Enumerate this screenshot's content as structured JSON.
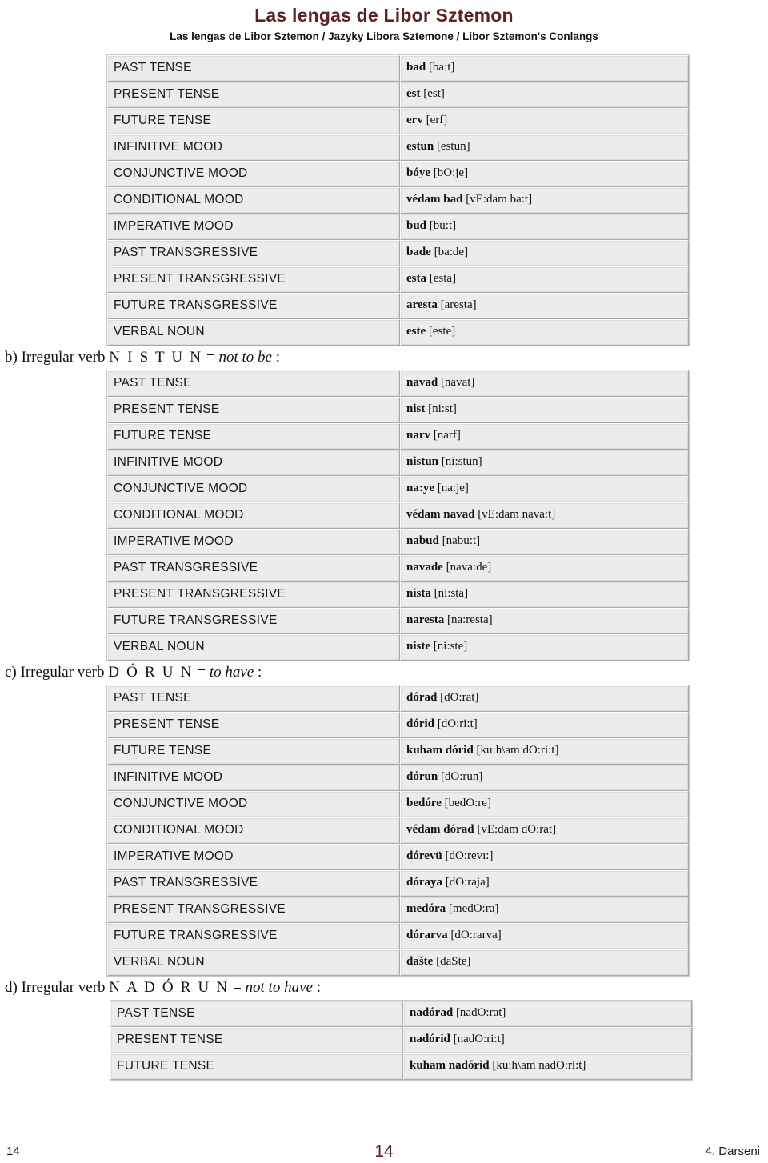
{
  "header": {
    "title": "Las lengas de Libor Sztemon",
    "subtitle": "Las lengas de Libor Sztemon / Jazyky Libora Sztemone / Libor Sztemon's Conlangs"
  },
  "sections": [
    {
      "id": "verb-a",
      "heading_prefix": "",
      "verb_name": "",
      "gloss": "",
      "rows": [
        {
          "label": "PAST TENSE",
          "form": "bad",
          "ipa": "[ba:t]"
        },
        {
          "label": "PRESENT TENSE",
          "form": "est",
          "ipa": "[est]"
        },
        {
          "label": "FUTURE TENSE",
          "form": "erv",
          "ipa": "[erf]"
        },
        {
          "label": "INFINITIVE MOOD",
          "form": "estun",
          "ipa": "[estun]"
        },
        {
          "label": "CONJUNCTIVE MOOD",
          "form": "bóye",
          "ipa": "[bO:je]"
        },
        {
          "label": "CONDITIONAL MOOD",
          "form": "védam bad",
          "ipa": "[vE:dam ba:t]"
        },
        {
          "label": "IMPERATIVE MOOD",
          "form": "bud",
          "ipa": "[bu:t]"
        },
        {
          "label": "PAST TRANSGRESSIVE",
          "form": "bade",
          "ipa": "[ba:de]"
        },
        {
          "label": "PRESENT TRANSGRESSIVE",
          "form": "esta",
          "ipa": "[esta]"
        },
        {
          "label": "FUTURE TRANSGRESSIVE",
          "form": "aresta",
          "ipa": "[aresta]"
        },
        {
          "label": "VERBAL NOUN",
          "form": "este",
          "ipa": "[este]"
        }
      ]
    },
    {
      "id": "verb-b",
      "heading_prefix": "b) Irregular verb ",
      "verb_name": "N I S T U N",
      "heading_equals": " = ",
      "gloss": "not to be",
      "heading_suffix": " :",
      "rows": [
        {
          "label": "PAST TENSE",
          "form": "navad",
          "ipa": "[navat]"
        },
        {
          "label": "PRESENT TENSE",
          "form": "nist",
          "ipa": "[ni:st]"
        },
        {
          "label": "FUTURE TENSE",
          "form": "narv",
          "ipa": "[narf]"
        },
        {
          "label": "INFINITIVE MOOD",
          "form": "nistun",
          "ipa": "[ni:stun]"
        },
        {
          "label": "CONJUNCTIVE MOOD",
          "form": "na:ye",
          "ipa": "[na:je]"
        },
        {
          "label": "CONDITIONAL MOOD",
          "form": "védam navad",
          "ipa": "[vE:dam nava:t]"
        },
        {
          "label": "IMPERATIVE MOOD",
          "form": "nabud",
          "ipa": "[nabu:t]"
        },
        {
          "label": "PAST TRANSGRESSIVE",
          "form": "navade",
          "ipa": "[nava:de]"
        },
        {
          "label": "PRESENT TRANSGRESSIVE",
          "form": "nista",
          "ipa": "[ni:sta]"
        },
        {
          "label": "FUTURE TRANSGRESSIVE",
          "form": "naresta",
          "ipa": "[na:resta]"
        },
        {
          "label": "VERBAL NOUN",
          "form": "niste",
          "ipa": "[ni:ste]"
        }
      ]
    },
    {
      "id": "verb-c",
      "heading_prefix": "c) Irregular verb ",
      "verb_name": "D Ó R U N",
      "heading_equals": " = ",
      "gloss": "to have",
      "heading_suffix": " :",
      "rows": [
        {
          "label": "PAST TENSE",
          "form": "dórad",
          "ipa": "[dO:rat]"
        },
        {
          "label": "PRESENT TENSE",
          "form": "dórid",
          "ipa": "[dO:ri:t]"
        },
        {
          "label": "FUTURE TENSE",
          "form": "kuham dórid",
          "ipa": "[ku:h\\am dO:ri:t]"
        },
        {
          "label": "INFINITIVE MOOD",
          "form": "dórun",
          "ipa": "[dO:run]"
        },
        {
          "label": "CONJUNCTIVE MOOD",
          "form": "bedóre",
          "ipa": "[bedO:re]"
        },
        {
          "label": "CONDITIONAL MOOD",
          "form": "védam dórad",
          "ipa": "[vE:dam dO:rat]"
        },
        {
          "label": "IMPERATIVE MOOD",
          "form": "dórevü",
          "ipa": "[dO:revı:]"
        },
        {
          "label": "PAST TRANSGRESSIVE",
          "form": "dóraya",
          "ipa": "[dO:raja]"
        },
        {
          "label": "PRESENT TRANSGRESSIVE",
          "form": "medóra",
          "ipa": "[medO:ra]"
        },
        {
          "label": "FUTURE TRANSGRESSIVE",
          "form": "dórarva",
          "ipa": "[dO:rarva]"
        },
        {
          "label": "VERBAL NOUN",
          "form": "dašte",
          "ipa": "[daSte]"
        }
      ]
    },
    {
      "id": "verb-d",
      "heading_prefix": "d) Irregular verb ",
      "verb_name": "N A D Ó R U N",
      "heading_equals": " = ",
      "gloss": "not to have",
      "heading_suffix": " :",
      "rows": [
        {
          "label": "PAST TENSE",
          "form": "nadórad",
          "ipa": "[nadO:rat]"
        },
        {
          "label": "PRESENT TENSE",
          "form": "nadórid",
          "ipa": "[nadO:ri:t]"
        },
        {
          "label": "FUTURE TENSE",
          "form": "kuham nadórid",
          "ipa": "[ku:h\\am nadO:ri:t]"
        }
      ]
    }
  ],
  "footer": {
    "left": "14",
    "center": "14",
    "right": "4. Darseni"
  }
}
